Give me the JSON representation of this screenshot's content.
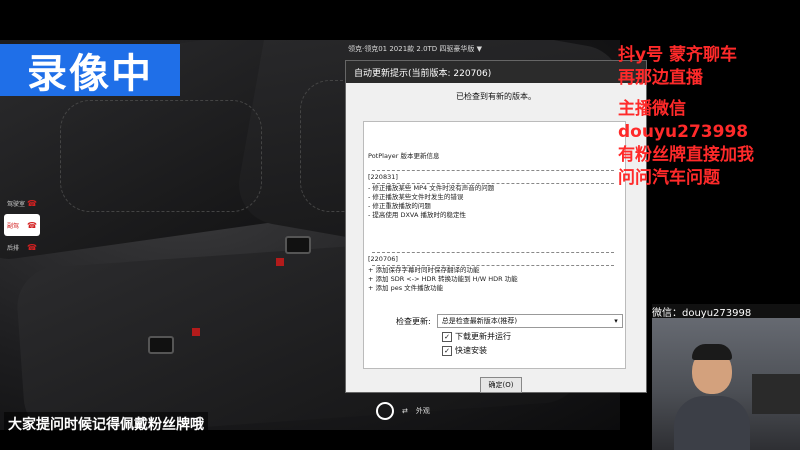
{
  "overlay": {
    "recording_label": "录像中",
    "subtitle": "大家提问时候记得佩戴粉丝牌哦"
  },
  "car_app": {
    "model_label": "领克·领克01 2021款 2.0TD 四驱豪华版 ▼",
    "side_menu": [
      "驾驶室",
      "副驾",
      "后排"
    ],
    "bottom_control_label": "外观"
  },
  "dialog": {
    "title": "自动更新提示(当前版本: 220706)",
    "status_text": "已检查到有新的版本。",
    "changelog": {
      "header": "PotPlayer 版本更新信息",
      "sections": [
        {
          "version": "[220831]",
          "items": [
            "- 修正播放某些 MP4 文件时没有声音的问题",
            "- 修正播放某些文件时发生的错误",
            "- 修正重放播放的问题",
            "- 提高使用 DXVA 播放时的稳定性"
          ]
        },
        {
          "version": "[220706]",
          "items": [
            "+ 添加保存字幕时同时保存翻译的功能",
            "+ 添加 SDR <-> HDR 转换功能到 H/W HDR 功能",
            "+ 添加 pes 文件播放功能"
          ]
        }
      ]
    },
    "check_update_label": "检查更新:",
    "check_update_value": "总是检查最新版本(推荐)",
    "checkbox_download": "下载更新并运行",
    "checkbox_silent": "快速安装",
    "ok_label": "确定(O)"
  },
  "right_panel": {
    "lines": [
      "抖y号  蒙齐聊车",
      "再那边直播",
      "主播微信",
      "douyu273998",
      "有粉丝牌直接加我",
      "问问汽车问题"
    ],
    "webcam_banner": "微信：douyu273998"
  },
  "colors": {
    "recording_bg": "#1f6fe8",
    "right_text": "#ff2a2a"
  }
}
